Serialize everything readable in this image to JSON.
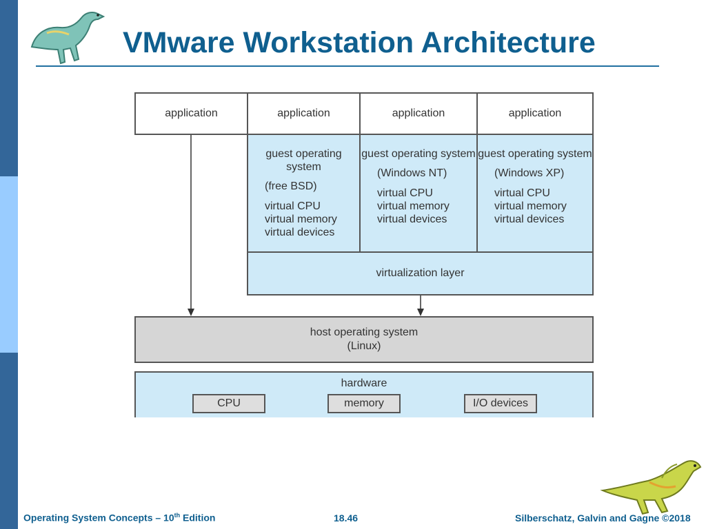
{
  "slide": {
    "title": "VMware Workstation Architecture"
  },
  "diagram": {
    "applications": [
      "application",
      "application",
      "application",
      "application"
    ],
    "guests": [
      {
        "os": "guest operating system",
        "name": "(free BSD)",
        "virtual": [
          "virtual CPU",
          "virtual memory",
          "virtual devices"
        ]
      },
      {
        "os": "guest operating system",
        "name": "(Windows NT)",
        "virtual": [
          "virtual CPU",
          "virtual memory",
          "virtual devices"
        ]
      },
      {
        "os": "guest operating system",
        "name": "(Windows XP)",
        "virtual": [
          "virtual CPU",
          "virtual memory",
          "virtual devices"
        ]
      }
    ],
    "virtualization_layer": "virtualization layer",
    "host_os": [
      "host operating system",
      "(Linux)"
    ],
    "hardware": {
      "label": "hardware",
      "components": [
        "CPU",
        "memory",
        "I/O devices"
      ]
    },
    "colors": {
      "guest_fill": "#cfeaf8",
      "host_fill": "#d6d6d6",
      "title": "#0f5f8f",
      "sidebar_dark": "#336699",
      "sidebar_light": "#99ccff"
    }
  },
  "footer": {
    "left_prefix": "Operating System Concepts – 10",
    "left_sup": "th",
    "left_suffix": " Edition",
    "center": "18.46",
    "right": "Silberschatz, Galvin and Gagne ©2018"
  },
  "icons": [
    "dinosaur-logo-icon",
    "dinosaur-mascot-icon"
  ]
}
